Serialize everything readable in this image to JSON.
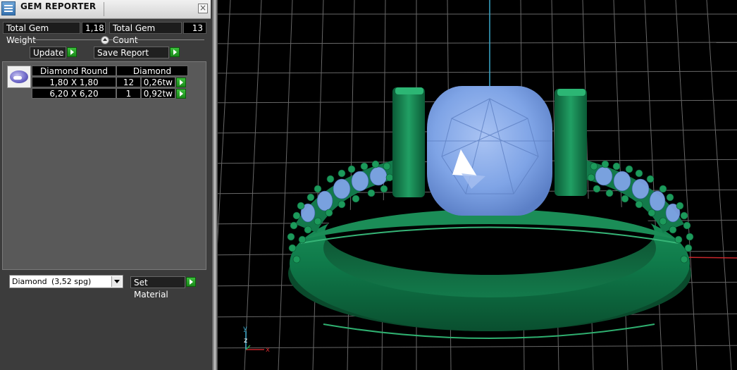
{
  "window": {
    "title": "GEM REPORTER",
    "close_symbol": "×"
  },
  "stats": {
    "total_weight_label": "Total Gem Weight",
    "total_weight_value": "1,18",
    "total_count_label": "Total Gem Count",
    "total_count_value": "13"
  },
  "actions": {
    "update_label": "Update",
    "save_report_label": "Save Report"
  },
  "gem_table": {
    "headers": [
      "Diamond Round",
      "Diamond"
    ],
    "rows": [
      {
        "size": "1,80 X 1,80",
        "count": "12",
        "weight": "0,26tw"
      },
      {
        "size": "6,20 X 6,20",
        "count": "1",
        "weight": "0,92tw"
      }
    ]
  },
  "material": {
    "selected_name": "Diamond",
    "selected_sg": "(3,52 spg)",
    "set_label": "Set Material"
  },
  "viewport": {
    "axis_y": "y",
    "axis_z": "z",
    "axis_x": "x"
  },
  "colors": {
    "metal": "#0f7a4a",
    "gem": "#7fa4e6",
    "grid": "#7a7a7a",
    "axis_blue": "#3aa7c9",
    "axis_red": "#c8262b",
    "go_button": "#2aa52a"
  },
  "icons": {
    "app": "gem-reporter-app-icon",
    "close": "close-icon",
    "collapse": "collapse-arrow-icon",
    "go": "play-arrow-icon",
    "gem_thumbnail": "round-diamond-icon",
    "dropdown": "chevron-down-icon"
  }
}
